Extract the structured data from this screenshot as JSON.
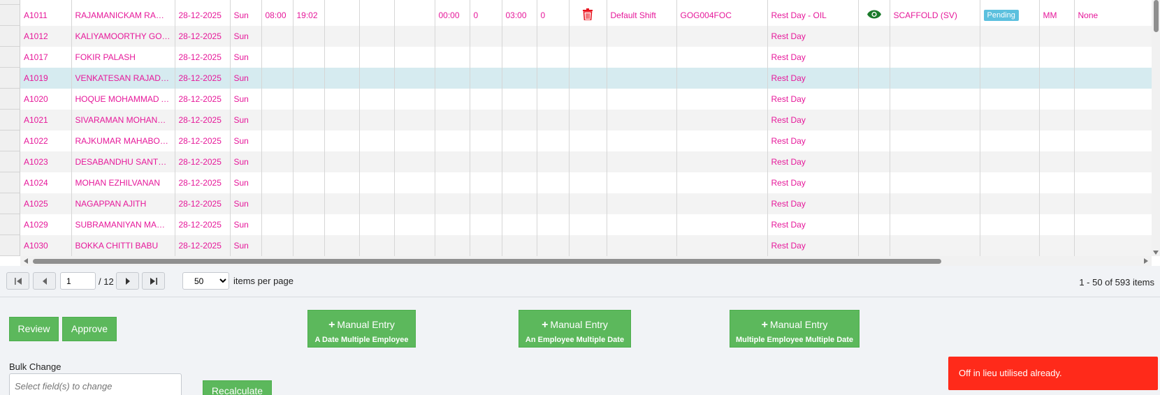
{
  "grid": {
    "first_row": {
      "id": "A1011",
      "name": "RAJAMANICKAM RAMASAMY",
      "date": "28-12-2025",
      "day": "Sun",
      "in_time": "08:00",
      "out_time": "19:02",
      "c1": "00:00",
      "c2": "0",
      "c3": "03:00",
      "c4": "0",
      "shift": "Default Shift",
      "code": "GOG004FOC",
      "rest": "Rest Day - OIL",
      "dept": "SCAFFOLD (SV)",
      "status": "Pending",
      "mm": "MM",
      "none": "None"
    },
    "rows": [
      {
        "id": "A1012",
        "name": "KALIYAMOORTHY GOVINDARAJ",
        "date": "28-12-2025",
        "day": "Sun",
        "rest": "Rest Day"
      },
      {
        "id": "A1017",
        "name": "FOKIR PALASH",
        "date": "28-12-2025",
        "day": "Sun",
        "rest": "Rest Day"
      },
      {
        "id": "A1019",
        "name": "VENKATESAN RAJADURAI",
        "date": "28-12-2025",
        "day": "Sun",
        "rest": "Rest Day"
      },
      {
        "id": "A1020",
        "name": "HOQUE MOHAMMAD ANWARUL",
        "date": "28-12-2025",
        "day": "Sun",
        "rest": "Rest Day"
      },
      {
        "id": "A1021",
        "name": "SIVARAMAN MOHANRAJ",
        "date": "28-12-2025",
        "day": "Sun",
        "rest": "Rest Day"
      },
      {
        "id": "A1022",
        "name": "RAJKUMAR MAHABOOB",
        "date": "28-12-2025",
        "day": "Sun",
        "rest": "Rest Day"
      },
      {
        "id": "A1023",
        "name": "DESABANDHU SANTHOSH",
        "date": "28-12-2025",
        "day": "Sun",
        "rest": "Rest Day"
      },
      {
        "id": "A1024",
        "name": "MOHAN EZHILVANAN",
        "date": "28-12-2025",
        "day": "Sun",
        "rest": "Rest Day"
      },
      {
        "id": "A1025",
        "name": "NAGAPPAN AJITH",
        "date": "28-12-2025",
        "day": "Sun",
        "rest": "Rest Day"
      },
      {
        "id": "A1029",
        "name": "SUBRAMANIYAN MARIAPPAN",
        "date": "28-12-2025",
        "day": "Sun",
        "rest": "Rest Day"
      },
      {
        "id": "A1030",
        "name": "BOKKA CHITTI BABU",
        "date": "28-12-2025",
        "day": "Sun",
        "rest": "Rest Day"
      }
    ],
    "selected_row_id": "A1019"
  },
  "pager": {
    "current_page": "1",
    "total_pages": "/ 12",
    "page_size": "50",
    "page_size_options": [
      "50"
    ],
    "items_per_page_label": "items per page",
    "range_info": "1 - 50 of 593 items"
  },
  "actions": {
    "review": "Review",
    "approve": "Approve",
    "entry_main": "Manual Entry",
    "entry1_sub": "A Date Multiple Employee",
    "entry2_sub": "An Employee Multiple Date",
    "entry3_sub": "Multiple Employee Multiple Date",
    "bulk_label": "Bulk Change",
    "bulk_placeholder": "Select field(s) to change",
    "recalculate": "Recalculate"
  },
  "toast": {
    "message": "Off in lieu utilised already."
  },
  "colors": {
    "text_pink": "#e6189a",
    "green": "#5cb85c",
    "toast_red": "#ff2a1a",
    "badge_blue": "#5bc0de",
    "selected_row": "#d6ebf0"
  }
}
